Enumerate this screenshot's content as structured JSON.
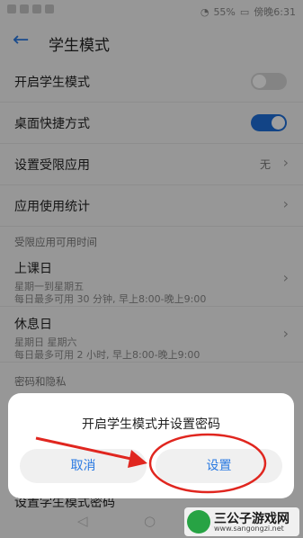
{
  "status": {
    "battery": "55%",
    "time": "傍晚6:31"
  },
  "header": {
    "title": "学生模式"
  },
  "rows": {
    "enable": "开启学生模式",
    "shortcut": "桌面快捷方式",
    "restricted": "设置受限应用",
    "restricted_value": "无",
    "stats": "应用使用统计"
  },
  "section_time": "受限应用可用时间",
  "school_day": {
    "title": "上课日",
    "days": "星期一到星期五",
    "limit": "每日最多可用 30 分钟, 早上8:00-晚上9:00"
  },
  "rest_day": {
    "title": "休息日",
    "days": "星期日 星期六",
    "limit": "每日最多可用 2 小时, 早上8:00-晚上9:00"
  },
  "section_privacy": "密码和隐私",
  "peek_row": "设置学生模式密码",
  "dialog": {
    "message": "开启学生模式并设置密码",
    "cancel": "取消",
    "confirm": "设置"
  },
  "toggles": {
    "enable": false,
    "shortcut": true
  },
  "colors": {
    "accent": "#1e6fd9",
    "annotation": "#e0261f"
  },
  "watermark": {
    "brand": "三公子游戏网",
    "url": "www.sangongzi.net"
  },
  "icons": {
    "back": "arrow-left-icon",
    "chevron": "chevron-right-icon"
  }
}
